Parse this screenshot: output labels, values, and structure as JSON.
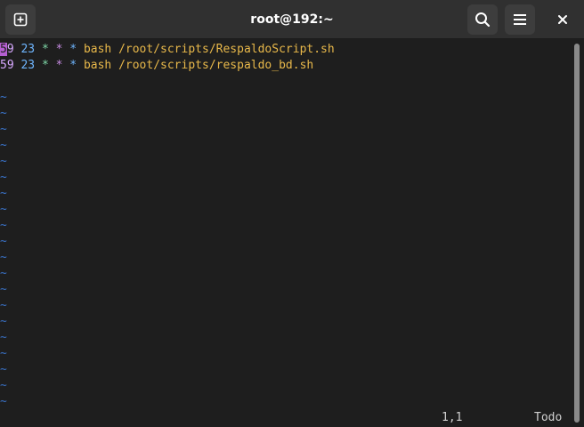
{
  "window": {
    "title": "root@192:~"
  },
  "icons": {
    "new_tab": "new-tab-icon",
    "search": "search-icon",
    "menu": "hamburger-menu-icon",
    "close": "close-icon"
  },
  "editor": {
    "lines": [
      {
        "minute_cursor": "5",
        "minute_rest": "9",
        "hour": "23",
        "star1": "*",
        "star2": "*",
        "star3": "*",
        "command": "bash /root/scripts/RespaldoScript.sh"
      },
      {
        "minute": "59",
        "hour": "23",
        "star1": "*",
        "star2": "*",
        "star3": "*",
        "command": "bash /root/scripts/respaldo_bd.sh"
      }
    ],
    "empty_line_marker": "~",
    "status": {
      "position": "1,1",
      "scroll": "Todo"
    }
  },
  "colors": {
    "background": "#1e1e1e",
    "titlebar": "#303030",
    "cursor": "#b55fd1",
    "minute": "#d7a8ff",
    "hour": "#6fb6ff",
    "command": "#e8b84a",
    "tilde": "#3a73c9"
  }
}
